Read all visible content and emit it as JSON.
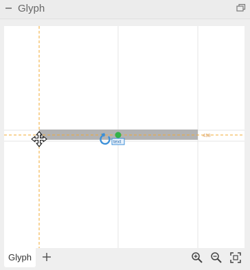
{
  "panel": {
    "title": "Glyph",
    "collapse_icon": "minus-icon",
    "window_icon": "window-restore-icon"
  },
  "canvas": {
    "guide_color": "#f0a830",
    "bar_color": "#b3b3b3",
    "grid_color": "#e6e6e6",
    "rotate_icon_color": "#3b8fd8",
    "anchor_color": "#33b24a",
    "guide_label": "438",
    "text_box_label": "text"
  },
  "tabs": [
    {
      "label": "Glyph",
      "active": true
    }
  ],
  "toolbar": {
    "add_icon": "plus-icon",
    "zoom_in_icon": "zoom-in-icon",
    "zoom_out_icon": "zoom-out-icon",
    "fit_icon": "fit-to-screen-icon"
  }
}
